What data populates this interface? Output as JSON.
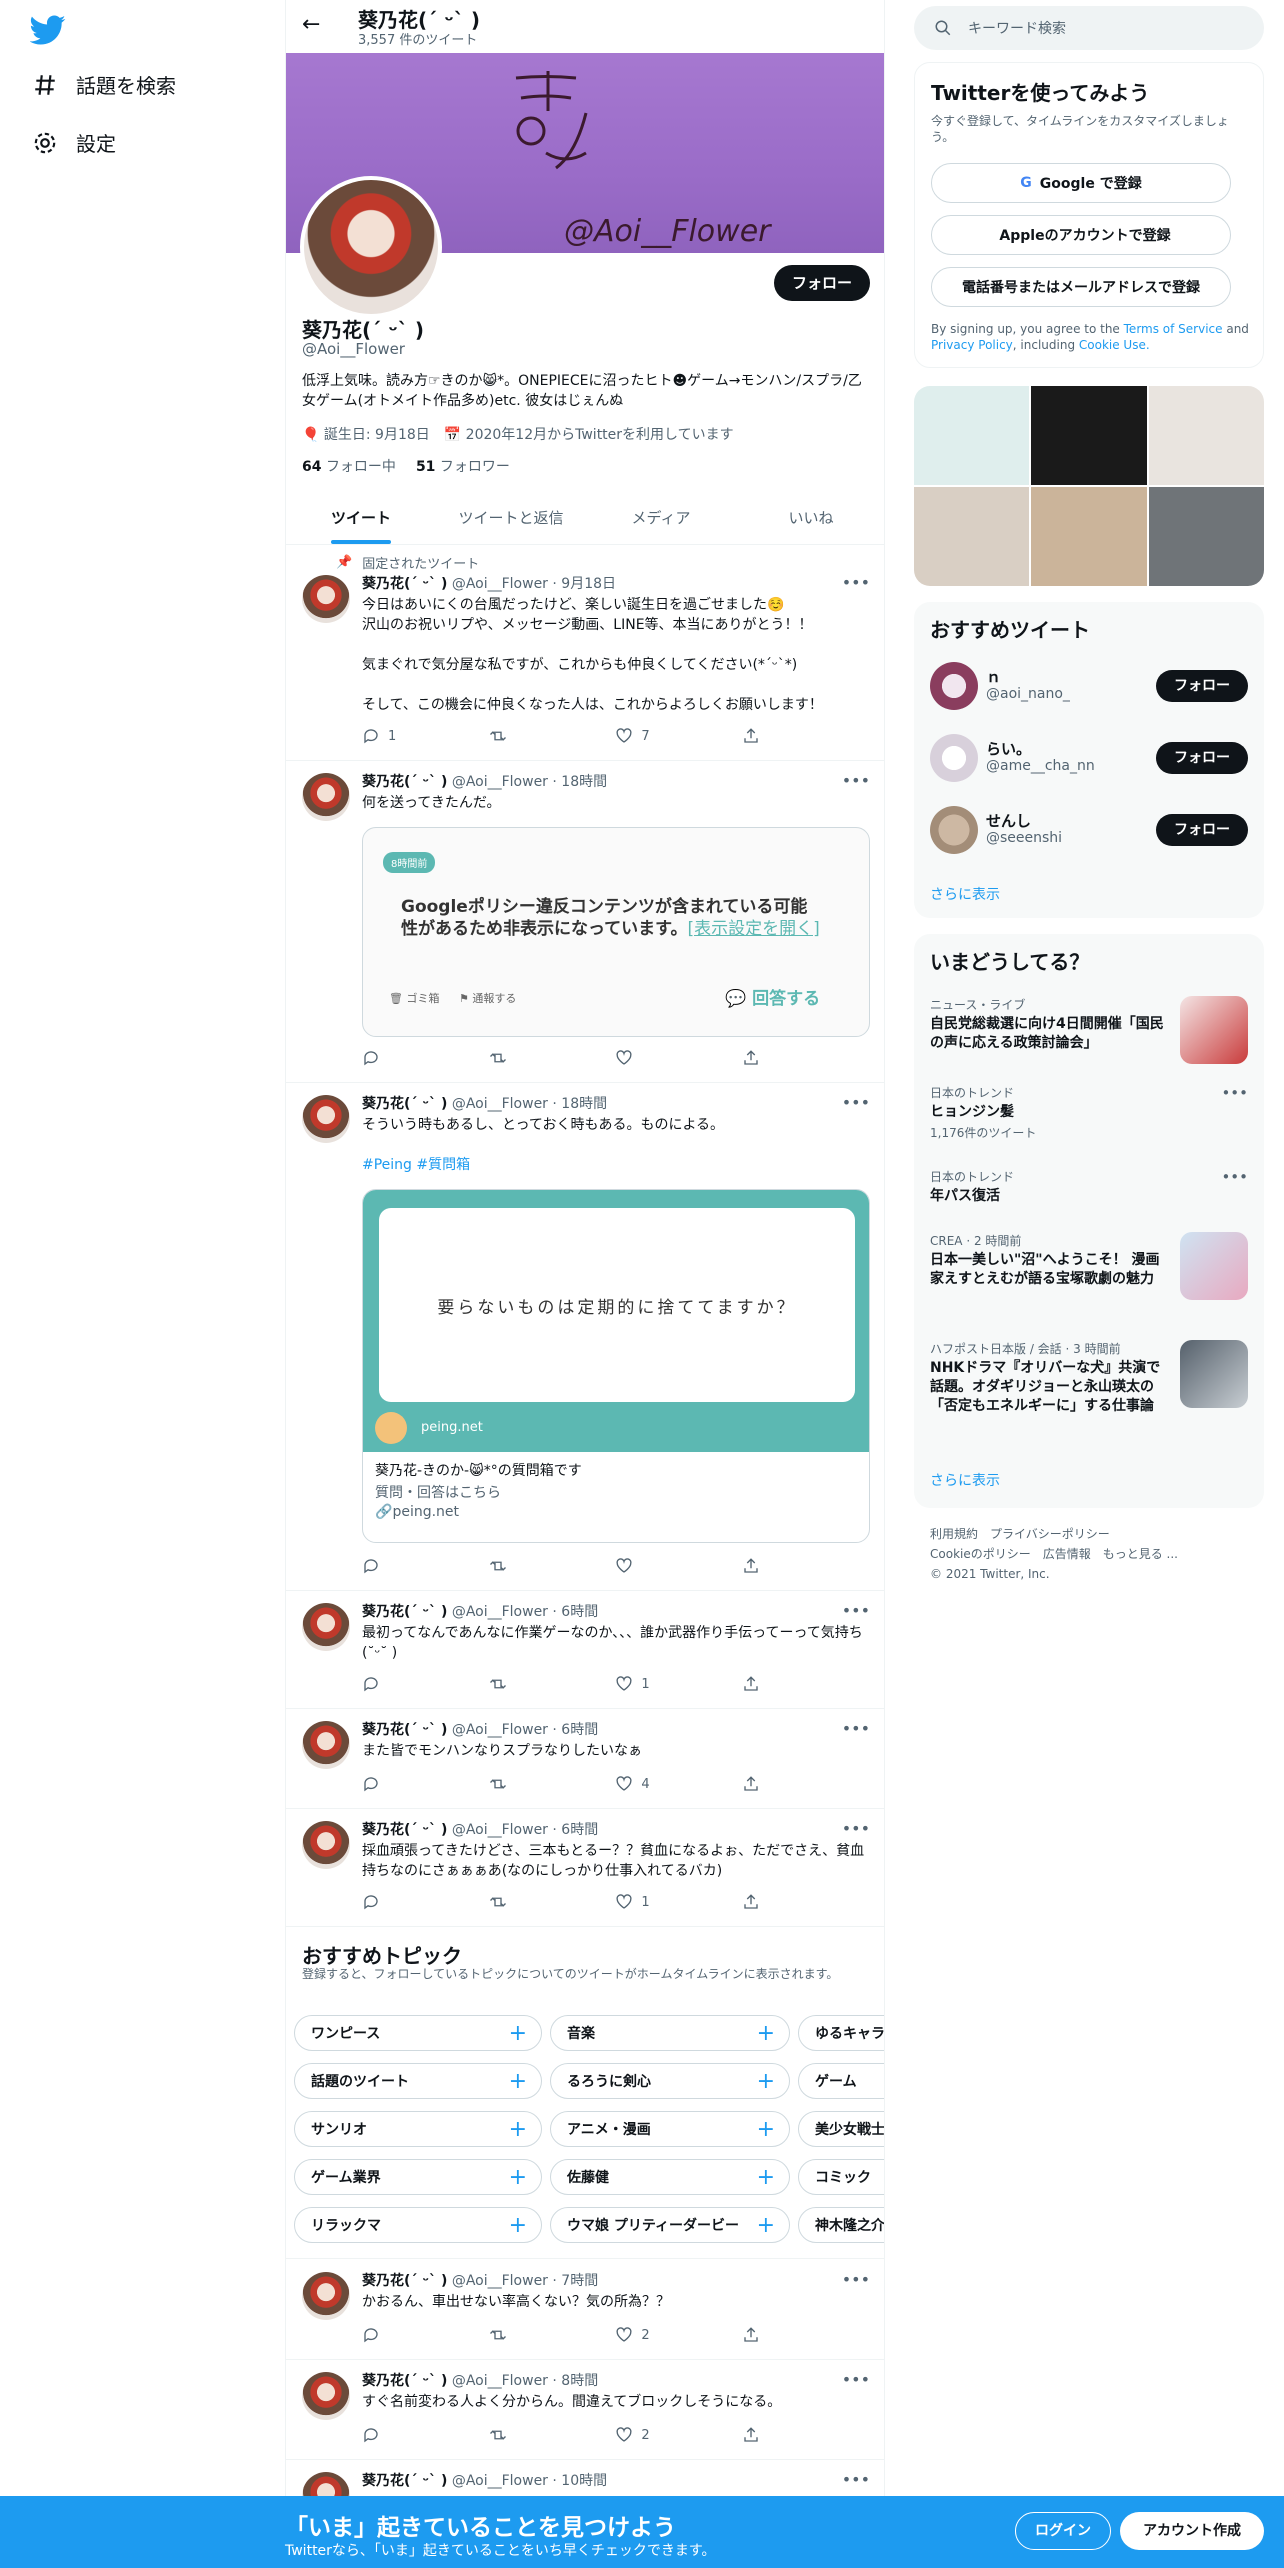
{
  "leftnav": {
    "explore_label": "話題を検索",
    "settings_label": "設定"
  },
  "topbar": {
    "name": "葵乃花(ˊ ᵕˋ )",
    "tweet_count": "3,557 件のツイート"
  },
  "profile": {
    "name": "葵乃花(ˊ ᵕˋ )",
    "handle": "@Aoi__Flower",
    "follow_label": "フォロー",
    "bio": "低浮上気味。読み方☞きのか😸*。ONEPIECEに沼ったヒト☻ゲーム→モンハン/スプラ/乙女ゲーム(オトメイト作品多め)etc. 彼女はじぇんぬ",
    "birthday": "誕生日: 9月18日",
    "joined": "2020年12月からTwitterを利用しています",
    "following_count": "64",
    "following_label": "フォロー中",
    "followers_count": "51",
    "followers_label": "フォロワー"
  },
  "tabs": [
    "ツイート",
    "ツイートと返信",
    "メディア",
    "いいね"
  ],
  "tweets": [
    {
      "pinned_label": "固定されたツイート",
      "name": "葵乃花(ˊ ᵕˋ )",
      "handle": "@Aoi__Flower",
      "time": "· 9月18日",
      "text": "今日はあいにくの台風だったけど、楽しい誕生日を過ごせました☺️\n沢山のお祝いリプや、メッセージ動画、LINE等、本当にありがとう！！\n\n気まぐれで気分屋な私ですが、これからも仲良くしてください(*ˊᵕˋ*)\n\nそして、この機会に仲良くなった人は、これからよろしくお願いします！",
      "replies": "1",
      "retweets": "",
      "likes": "7"
    },
    {
      "name": "葵乃花(ˊ ᵕˋ )",
      "handle": "@Aoi__Flower",
      "time": "· 18時間",
      "text": "何を送ってきたんだ。",
      "card": {
        "badge": "8時間前",
        "message": "Googleポリシー違反コンテンツが含まれている可能性があるため非表示になっています。",
        "link": "[表示設定を開く]",
        "trash": "ゴミ箱",
        "report": "通報する",
        "answer": "回答する"
      }
    },
    {
      "name": "葵乃花(ˊ ᵕˋ )",
      "handle": "@Aoi__Flower",
      "time": "· 18時間",
      "text": "そういう時もあるし、とっておく時もある。ものによる。",
      "hashtags": "#Peing #質問箱",
      "card": {
        "question": "要らないものは定期的に捨ててますか？",
        "site": "peing.net",
        "title": "葵乃花-きのか-😸*°の質問箱です",
        "desc": "質問・回答はこちら",
        "domain": "peing.net"
      }
    },
    {
      "name": "葵乃花(ˊ ᵕˋ )",
      "handle": "@Aoi__Flower",
      "time": "· 6時間",
      "text": "最初ってなんであんなに作業ゲーなのか、、、誰か武器作り手伝ってーって気持ち(˘ᵕ˘ )",
      "likes": "1"
    },
    {
      "name": "葵乃花(ˊ ᵕˋ )",
      "handle": "@Aoi__Flower",
      "time": "· 6時間",
      "text": "また皆でモンハンなりスプラなりしたいなぁ",
      "likes": "4"
    },
    {
      "name": "葵乃花(ˊ ᵕˋ )",
      "handle": "@Aoi__Flower",
      "time": "· 6時間",
      "text": "採血頑張ってきたけどさ、三本もとるー？？貧血になるよぉ、ただでさえ、貧血持ちなのにさぁぁぁあ(なのにしっかり仕事入れてるバカ)",
      "likes": "1"
    },
    {
      "name": "葵乃花(ˊ ᵕˋ )",
      "handle": "@Aoi__Flower",
      "time": "· 7時間",
      "text": "かおるん、車出せない率高くない？気の所為？？",
      "likes": "2"
    },
    {
      "name": "葵乃花(ˊ ᵕˋ )",
      "handle": "@Aoi__Flower",
      "time": "· 8時間",
      "text": "すぐ名前変わる人よく分からん。間違えてブロックしそうになる。",
      "likes": "2"
    },
    {
      "name": "葵乃花(ˊ ᵕˋ )",
      "handle": "@Aoi__Flower",
      "time": "· 10時間"
    }
  ],
  "topics": {
    "title": "おすすめトピック",
    "subtitle": "登録すると、フォローしているトピックについてのツイートがホームタイムラインに表示されます。",
    "chips": [
      "ワンピース",
      "音楽",
      "ゆるキャラ",
      "話題のツイート",
      "るろうに剣心",
      "ゲーム",
      "サンリオ",
      "アニメ・漫画",
      "美少女戦士セーラームーン",
      "ゲーム業界",
      "佐藤健",
      "コミック",
      "リラックマ",
      "ウマ娘 プリティーダービー",
      "神木隆之介"
    ]
  },
  "right": {
    "search_placeholder": "キーワード検索",
    "signup": {
      "title": "Twitterを使ってみよう",
      "subtitle": "今すぐ登録して、タイムラインをカスタマイズしましょう。",
      "google": "Google で登録",
      "apple": "Appleのアカウントで登録",
      "phone": "電話番号またはメールアドレスで登録",
      "terms_prefix": "By signing up, you agree to the ",
      "terms": "Terms of Service",
      "and": " and ",
      "privacy": "Privacy Policy",
      "including": ", including ",
      "cookie": "Cookie Use."
    },
    "who": {
      "title": "おすすめツイート",
      "items": [
        {
          "name": "ｎ",
          "handle": "@aoi_nano_",
          "button": "フォロー"
        },
        {
          "name": "らい。",
          "handle": "@ame__cha_nn",
          "button": "フォロー"
        },
        {
          "name": "せんし",
          "handle": "@seeenshi",
          "button": "フォロー"
        }
      ],
      "more": "さらに表示"
    },
    "trends": {
      "title": "いまどうしてる？",
      "items": [
        {
          "context": "ニュース・ライブ",
          "title": "自民党総裁選に向け4日間開催「国民の声に応える政策討論会」"
        },
        {
          "context": "日本のトレンド",
          "title": "ヒョンジン髪",
          "count": "1,176件のツイート"
        },
        {
          "context": "日本のトレンド",
          "title": "年パス復活"
        },
        {
          "context": "CREA · 2 時間前",
          "title": "日本一美しい\"沼\"へようこそ！ 漫画家えすとえむが語る宝塚歌劇の魅力"
        },
        {
          "context": "ハフポスト日本版 / 会話 · 3 時間前",
          "title": "NHKドラマ『オリバーな犬』共演で話題。オダギリジョーと永山瑛太の「否定もエネルギーに」する仕事論"
        }
      ],
      "more": "さらに表示"
    },
    "footer": {
      "line1": "利用規約　プライバシーポリシー",
      "line2": "Cookieのポリシー　広告情報　もっと見る ...",
      "line3": "© 2021 Twitter, Inc."
    }
  },
  "bottom": {
    "title": "「いま」起きていることを見つけよう",
    "subtitle": "Twitterなら、「いま」起きていることをいち早くチェックできます。",
    "login": "ログイン",
    "signup": "アカウント作成"
  },
  "colors": {
    "accent": "#1d9bf0",
    "peing": "#5cb8b2",
    "banner": "#a678d0"
  }
}
